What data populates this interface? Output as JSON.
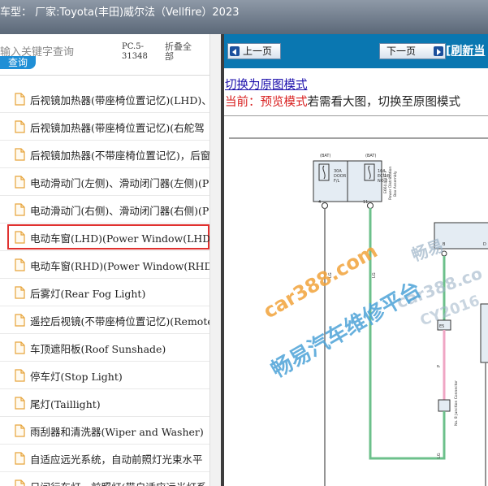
{
  "window": {
    "title": "车型： 厂家:Toyota(丰田)威尔法（Vellfire）2023"
  },
  "search": {
    "placeholder": "输入关键字查询",
    "button_label": "查询",
    "code": "PC.5-31348",
    "collapse_label": "折叠全部"
  },
  "tree": {
    "items": [
      {
        "label": "后视镜加热器(带座椅位置记忆)(LHD)、"
      },
      {
        "label": "后视镜加热器(带座椅位置记忆)(右舵驾"
      },
      {
        "label": "后视镜加热器(不带座椅位置记忆)，后窗"
      },
      {
        "label": "电动滑动门(左侧)、滑动闭门器(左侧)(P"
      },
      {
        "label": "电动滑动门(右侧)、滑动闭门器(右侧)(P"
      },
      {
        "label": "电动车窗(LHD)(Power Window(LHD))"
      },
      {
        "label": "电动车窗(RHD)(Power Window(RHD))"
      },
      {
        "label": "后雾灯(Rear Fog Light)"
      },
      {
        "label": "遥控后视镜(不带座椅位置记忆)(Remote"
      },
      {
        "label": "车顶遮阳板(Roof Sunshade)"
      },
      {
        "label": "停车灯(Stop Light)"
      },
      {
        "label": "尾灯(Taillight)"
      },
      {
        "label": "雨刮器和清洗器(Wiper and Washer)"
      },
      {
        "label": "自适应远光系统，自动前照灯光束水平"
      },
      {
        "label": "日间行车灯，前照灯(带自适应远光灯系"
      }
    ],
    "selected_index": 5,
    "file_icon": "file-icon"
  },
  "toolbar": {
    "prev_label": "上一页",
    "next_label": "下一页",
    "refresh_label": "[刷新当"
  },
  "view": {
    "original_link": "切换为原图模式",
    "current_prefix": "当前：",
    "current_mode": "预览模式",
    "hint": "若需看大图，切换至原图模式"
  },
  "diagram": {
    "fuse1": {
      "top": "(BAT)",
      "amp": "30A",
      "name1": "DOOR",
      "name2": "F/L"
    },
    "fuse2": {
      "top": "(BAT)",
      "amp": "10A",
      "name1": "ECU-B",
      "name2": "NO.2"
    },
    "side_label1": "E66(L)(4)(F)",
    "side_label2": "Power Distribution",
    "side_label3": "Box Assembly",
    "pin_labels": [
      "4",
      "11",
      "1",
      "2",
      "B",
      "A",
      "D"
    ],
    "wire_labels": [
      "LG",
      "LG",
      "P",
      "LG"
    ],
    "connector_labels": [
      "E5",
      "E64",
      "No. 8 Junction Connector"
    ],
    "watermarks": [
      "car388.com",
      "畅易",
      "car388.co",
      "CY2016",
      "畅易汽车维修平台"
    ]
  },
  "colors": {
    "titlebar": "#5b6878",
    "nav_bar": "#0a77b1",
    "selection_border": "#e0312f",
    "search_button": "#1f8fd6",
    "wire_green": "#6cc08b",
    "wire_pink": "#f0a6c4",
    "watermark": "#4da3d8",
    "watermark_orange": "#f2a33a"
  }
}
